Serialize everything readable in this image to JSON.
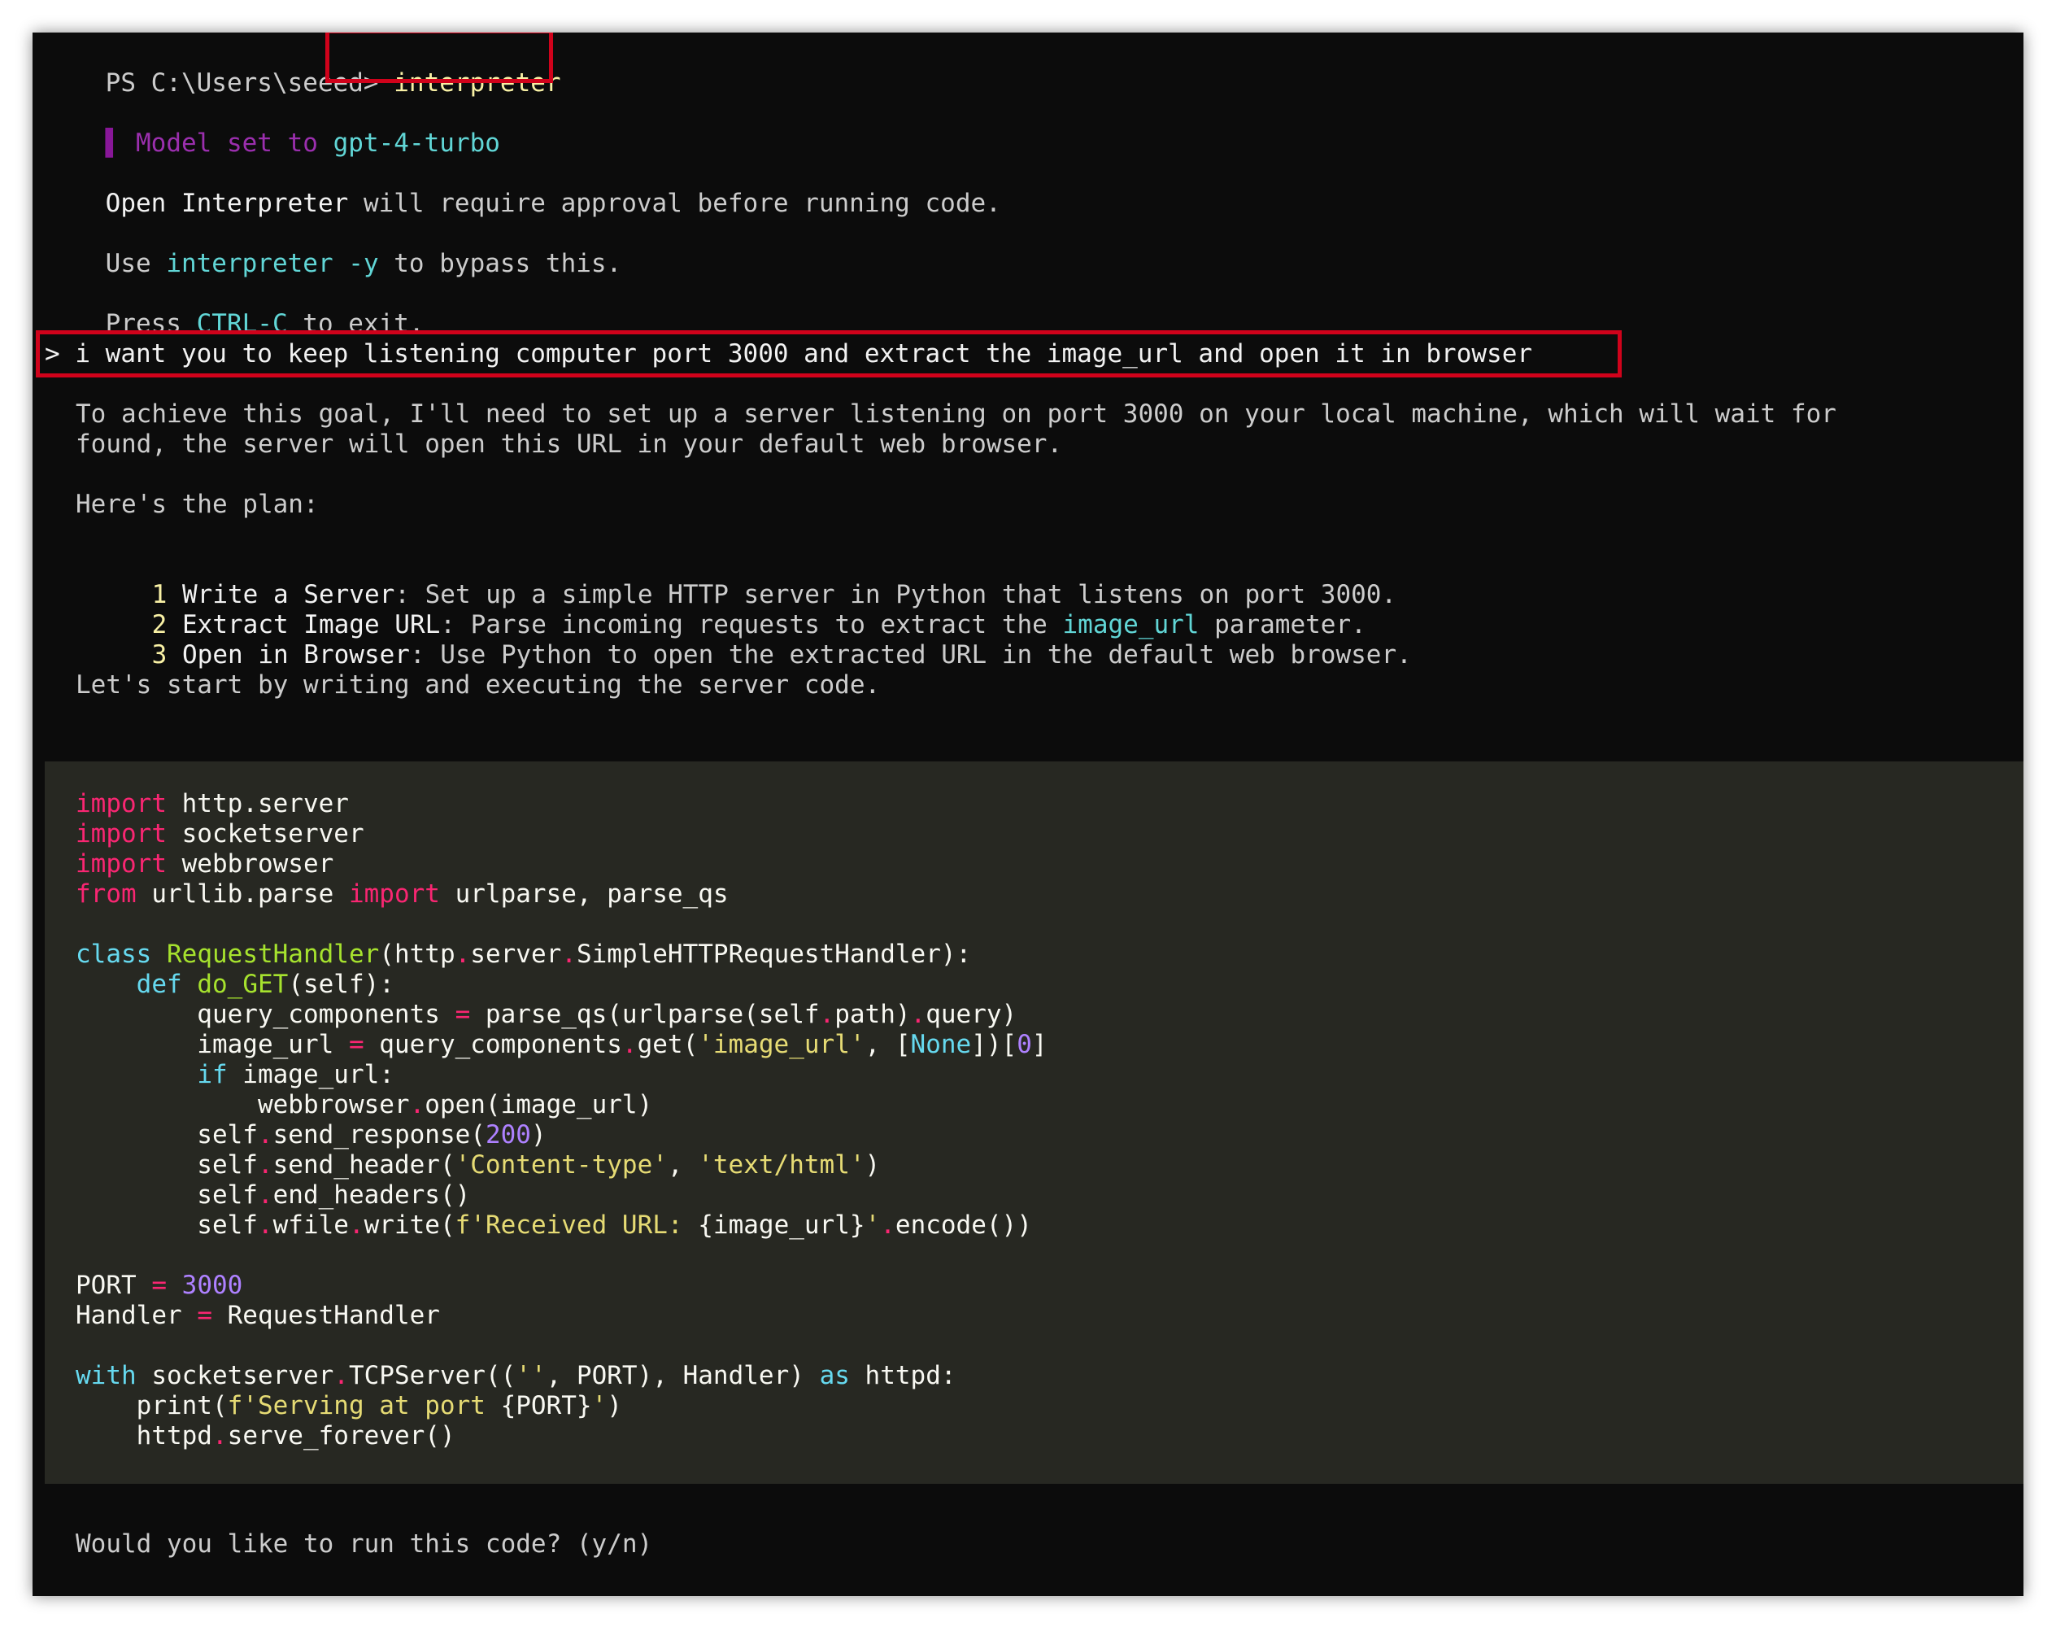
{
  "terminal": {
    "prompt": "PS C:\\Users\\seeed>",
    "command": " interpreter",
    "model_label": "Model set to",
    "model_value": "gpt-4-turbo",
    "approval": {
      "product": "Open Interpreter",
      "rest": " will require approval before running code."
    },
    "bypass": {
      "pre": "Use ",
      "cmd": "interpreter -y",
      "post": " to bypass this."
    },
    "exit": {
      "pre": "Press ",
      "key": "CTRL-C",
      "post": " to exit."
    },
    "user_input": "> i want you to keep listening computer port 3000 and extract the image_url and open it in browser",
    "response": {
      "line1": "To achieve this goal, I'll need to set up a server listening on port 3000 on your local machine, which will wait for",
      "line2": "found, the server will open this URL in your default web browser.",
      "plan_header": "Here's the plan:",
      "plan": [
        {
          "num": "1",
          "title": "Write a Server",
          "text": ": Set up a simple HTTP server in Python that listens on port 3000."
        },
        {
          "num": "2",
          "title": "Extract Image URL",
          "text_pre": ": Parse incoming requests to extract the ",
          "code": "image_url",
          "text_post": " parameter."
        },
        {
          "num": "3",
          "title": "Open in Browser",
          "text": ": Use Python to open the extracted URL in the default web browser."
        }
      ],
      "closing": "Let's start by writing and executing the server code."
    },
    "question": "Would you like to run this code? (y/n)"
  }
}
